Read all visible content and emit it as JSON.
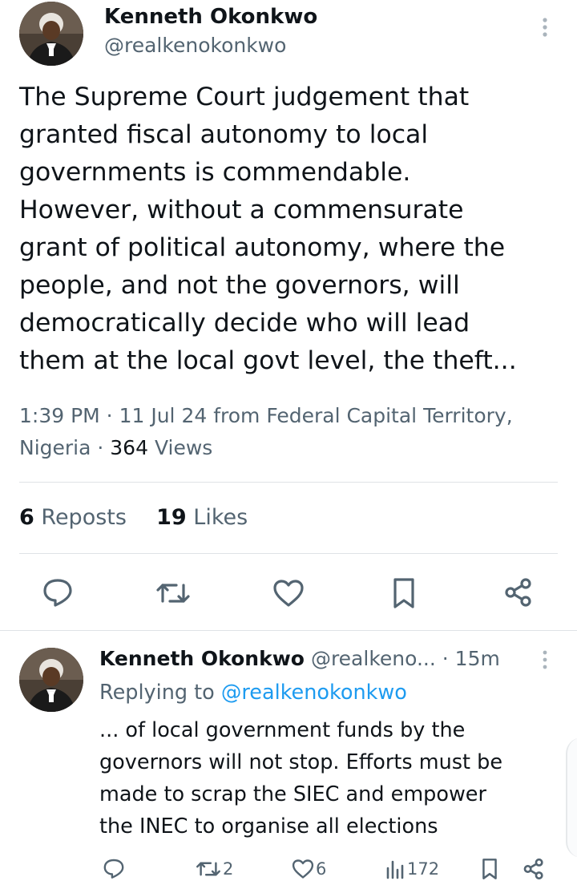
{
  "tweet": {
    "author_name": "Kenneth Okonkwo",
    "author_handle": "@realkenokonkwo",
    "text_lines": [
      "The Supreme Court judgement that",
      "granted fiscal autonomy to local",
      "governments is commendable.",
      "However, without a commensurate",
      "grant of political autonomy, where the",
      "people, and not the governors, will",
      "democratically decide who will lead",
      "them at the local govt level, the theft..."
    ],
    "meta_line1": "1:39 PM · 11 Jul 24 from Federal Capital Territory,",
    "meta_line2_prefix": "Nigeria · ",
    "views_count": "364",
    "views_label": " Views",
    "reposts_count": "6",
    "reposts_label": "Reposts",
    "likes_count": "19",
    "likes_label": "Likes",
    "icons": [
      "more-vertical-icon",
      "reply-icon",
      "repost-icon",
      "like-icon",
      "bookmark-icon",
      "share-icon"
    ]
  },
  "reply": {
    "author_name": "Kenneth Okonkwo",
    "author_handle_trunc": "@realkeno...",
    "time": "· 15m",
    "replying_to_prefix": "Replying to ",
    "replying_to_handle": "@realkenokonkwo",
    "text_lines": [
      "... of local government funds by the",
      "governors will not stop. Efforts must be",
      "made to scrap the SIEC and empower",
      "the INEC to organise all elections"
    ],
    "repost_count": "2",
    "like_count": "6",
    "views_count": "172"
  },
  "colors": {
    "text": "#0f1419",
    "secondary": "#536471",
    "link": "#1d9bf0",
    "divider": "#dfe3e6"
  }
}
